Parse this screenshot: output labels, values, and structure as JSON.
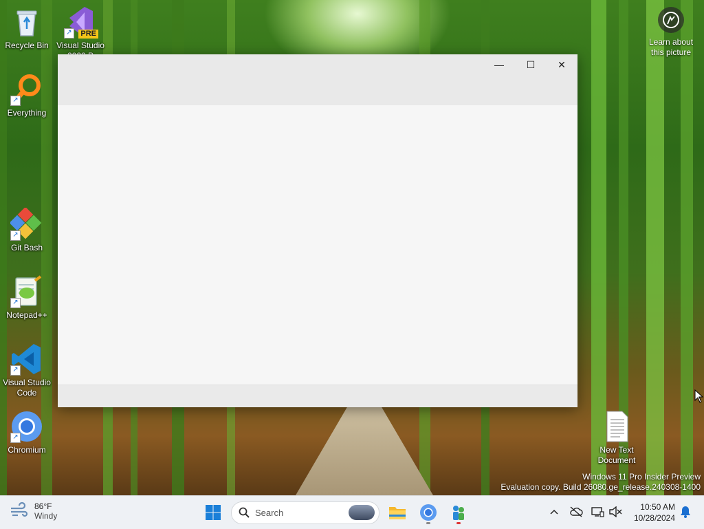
{
  "desktop": {
    "icons": [
      {
        "label": "Recycle Bin"
      },
      {
        "label": "Visual Studio 2022 P",
        "badge": "PRE"
      },
      {
        "label": "Everything"
      },
      {
        "label": "Git Bash"
      },
      {
        "label": "Notepad++"
      },
      {
        "label": "Visual Studio Code"
      },
      {
        "label": "Chromium"
      },
      {
        "label": "New Text Document"
      }
    ],
    "learn_about": "Learn about this picture",
    "watermark_line1": "Windows 11 Pro Insider Preview",
    "watermark_line2": "Evaluation copy. Build 26080.ge_release.240308-1400"
  },
  "window": {
    "minimize_glyph": "—",
    "maximize_glyph": "☐",
    "close_glyph": "✕"
  },
  "taskbar": {
    "weather_temp": "86°F",
    "weather_condition": "Windy",
    "search_placeholder": "Search",
    "time": "10:50 AM",
    "date": "10/28/2024",
    "tray_chevron": "^"
  },
  "colors": {
    "accent": "#0067c0",
    "taskbar_bg": "#eef1f5",
    "window_titlebar": "#e9e9e9"
  }
}
